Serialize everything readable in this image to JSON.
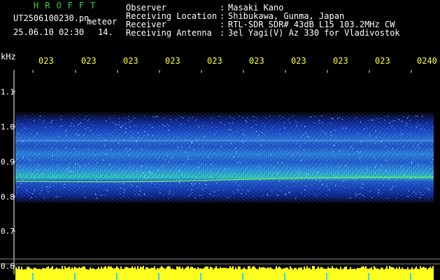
{
  "logo": "HROFFT",
  "file": {
    "name": "UT2506100230.pn",
    "type": "meteor",
    "datetime": "25.06.10 02:30",
    "number": "14."
  },
  "header": {
    "labels": [
      "Observer",
      "Receiving Location",
      "Receiver",
      "Receiving Antenna"
    ],
    "separators": [
      ":",
      ":",
      ":",
      ":"
    ],
    "values": [
      "Masaki Kano",
      "Shibukawa, Gunma, Japan",
      "RTL-SDR SDR# 43dB L15 103.2MHz CW",
      "3el Yagi(V) Az 330 for Vladivostok"
    ]
  },
  "axis": {
    "unit": "kHz",
    "y_ticks": [
      "1.1",
      "1.0",
      "0.9",
      "0.8",
      "0.7",
      "0.6"
    ],
    "time_ticks": [
      "023",
      "023",
      "023",
      "023",
      "023",
      "023",
      "023",
      "023",
      "023",
      "0240"
    ]
  },
  "colors": {
    "label_green": "#39d339",
    "text_white": "#ffffff",
    "time_yellow": "#ffff33",
    "noise_blue": "#1a4fd0",
    "trace_green": "#7fe36a"
  }
}
